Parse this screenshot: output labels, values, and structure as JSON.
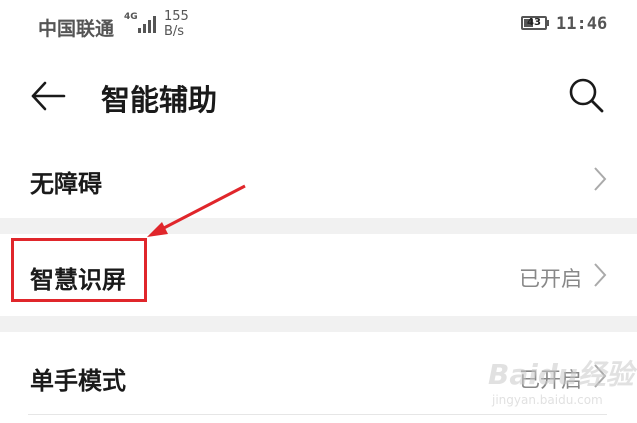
{
  "status_bar": {
    "carrier": "中国联通",
    "network_type": "4G",
    "speed_value": "155",
    "speed_unit": "B/s",
    "battery_level": "43",
    "battery_fraction": 0.43,
    "time": "11:46"
  },
  "header": {
    "title": "智能辅助",
    "back_icon": "back-arrow-icon",
    "search_icon": "search-icon"
  },
  "settings": [
    {
      "label": "无障碍",
      "value": ""
    },
    {
      "label": "智慧识屏",
      "value": "已开启"
    },
    {
      "label": "单手模式",
      "value": "已开启"
    }
  ],
  "annotation": {
    "color": "#e0262b"
  },
  "watermark": {
    "text": "Baidu经验",
    "url": "jingyan.baidu.com"
  }
}
